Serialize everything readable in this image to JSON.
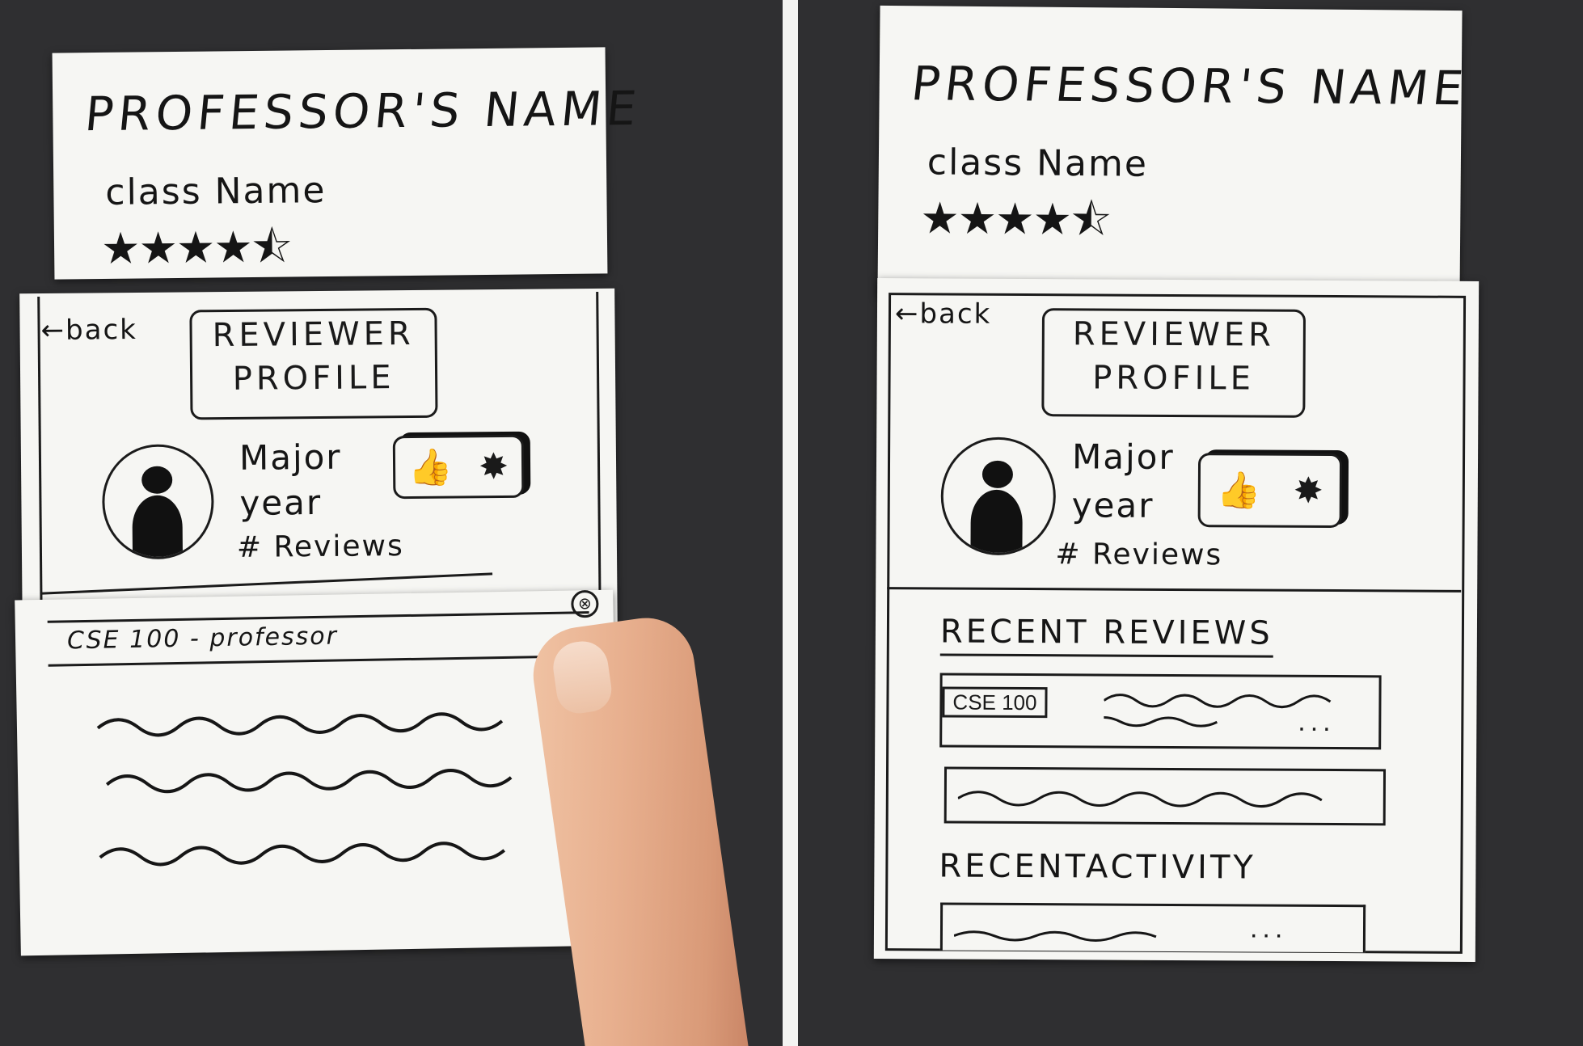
{
  "left": {
    "professor_name": "PROFESSOR'S NAME",
    "class_name": "class Name",
    "rating_stars": "★★★★⯪",
    "back": "←back",
    "title_line1": "REVIEWER",
    "title_line2": "PROFILE",
    "major": "Major",
    "year": "year",
    "reviews": "# Reviews",
    "thumb_icon": "👍",
    "badge_icon": "✸",
    "popup_title": "CSE 100 - professor",
    "close_icon": "⊗"
  },
  "right": {
    "professor_name": "PROFESSOR'S NAME",
    "class_name": "class Name",
    "rating_stars": "★★★★⯪",
    "back": "←back",
    "title_line1": "REVIEWER",
    "title_line2": "PROFILE",
    "major": "Major",
    "year": "year",
    "reviews": "# Reviews",
    "thumb_icon": "👍",
    "badge_icon": "✸",
    "recent_reviews": "RECENT REVIEWS",
    "review_tag": "CSE 100",
    "ellipsis": "...",
    "recent_activity": "RECENTACTIVITY"
  }
}
